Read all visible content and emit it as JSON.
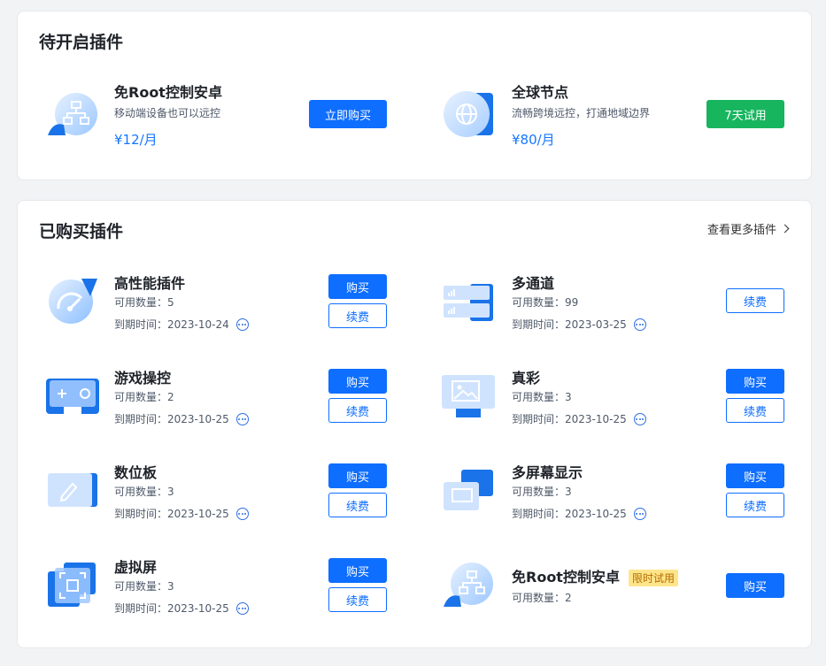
{
  "pending_section": {
    "title": "待开启插件",
    "items": [
      {
        "name": "免Root控制安卓",
        "desc": "移动端设备也可以远控",
        "price": "¥12/月",
        "button": "立即购买"
      },
      {
        "name": "全球节点",
        "desc": "流畅跨境远控，打通地域边界",
        "price": "¥80/月",
        "button": "7天试用"
      }
    ]
  },
  "purchased_section": {
    "title": "已购买插件",
    "more_link": "查看更多插件",
    "qty_label": "可用数量：",
    "expire_label": "到期时间：",
    "buy_label": "购买",
    "renew_label": "续费",
    "items": [
      {
        "name": "高性能插件",
        "qty": "5",
        "expire": "2023-10-24"
      },
      {
        "name": "多通道",
        "qty": "99",
        "expire": "2023-03-25"
      },
      {
        "name": "游戏操控",
        "qty": "2",
        "expire": "2023-10-25"
      },
      {
        "name": "真彩",
        "qty": "3",
        "expire": "2023-10-25"
      },
      {
        "name": "数位板",
        "qty": "3",
        "expire": "2023-10-25"
      },
      {
        "name": "多屏幕显示",
        "qty": "3",
        "expire": "2023-10-25"
      },
      {
        "name": "虚拟屏",
        "qty": "3",
        "expire": "2023-10-25"
      },
      {
        "name": "免Root控制安卓",
        "tag": "限时试用",
        "qty": "2"
      }
    ]
  },
  "colors": {
    "primary": "#0e6eff",
    "trial_green": "#17b55e",
    "tag_bg": "#ffe58a"
  }
}
